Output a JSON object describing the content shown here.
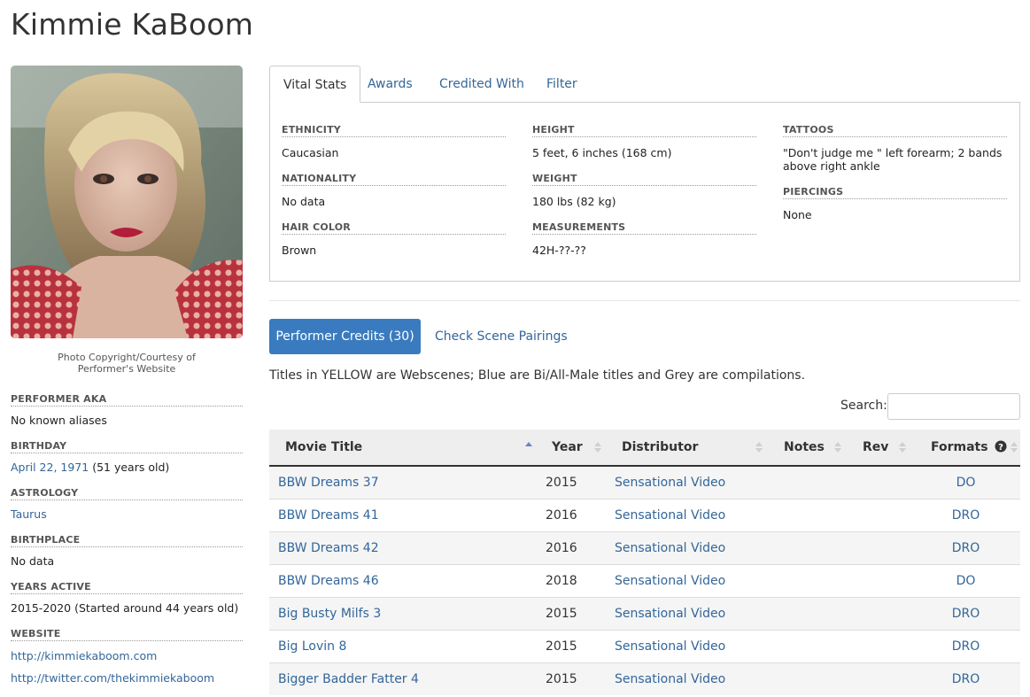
{
  "page": {
    "title": "Kimmie KaBoom"
  },
  "left": {
    "photo_credit_line1": "Photo Copyright/Courtesy of",
    "photo_credit_line2": "Performer's Website",
    "bio": [
      {
        "label": "Performer AKA",
        "value": "No known aliases",
        "link": false
      },
      {
        "label": "Birthday",
        "value_link": "April 22, 1971",
        "value_suffix": " (51 years old)"
      },
      {
        "label": "Astrology",
        "value": "Taurus",
        "link": true
      },
      {
        "label": "Birthplace",
        "value": "No data",
        "link": false
      },
      {
        "label": "Years Active",
        "value": "2015-2020 (Started around 44 years old)",
        "link": false
      },
      {
        "label": "Website",
        "links": [
          "http://kimmiekaboom.com",
          "http://twitter.com/thekimmiekaboom"
        ]
      }
    ]
  },
  "tabs": [
    {
      "label": "Vital Stats",
      "active": true
    },
    {
      "label": "Awards",
      "active": false
    },
    {
      "label": "Credited With",
      "active": false
    },
    {
      "label": "Filter",
      "active": false
    }
  ],
  "vital_stats": {
    "col1": [
      {
        "label": "Ethnicity",
        "value": "Caucasian"
      },
      {
        "label": "Nationality",
        "value": "No data"
      },
      {
        "label": "Hair Color",
        "value": "Brown"
      }
    ],
    "col2": [
      {
        "label": "Height",
        "value": "5 feet, 6 inches (168 cm)"
      },
      {
        "label": "Weight",
        "value": "180 lbs (82 kg)"
      },
      {
        "label": "Measurements",
        "value": "42H-??-??"
      }
    ],
    "col3": [
      {
        "label": "Tattoos",
        "value": "\"Don't judge me \" left forearm; 2 bands above right ankle"
      },
      {
        "label": "Piercings",
        "value": "None"
      }
    ]
  },
  "credits": {
    "button_label": "Performer Credits (30)",
    "pairings_label": "Check Scene Pairings",
    "legend": "Titles in YELLOW are Webscenes; Blue are Bi/All-Male titles and Grey are compilations.",
    "search_label": "Search:",
    "search_value": "",
    "columns": [
      "Movie Title",
      "Year",
      "Distributor",
      "Notes",
      "Rev",
      "Formats"
    ],
    "rows": [
      {
        "title": "BBW Dreams 37",
        "year": "2015",
        "distributor": "Sensational Video",
        "notes": "",
        "rev": "",
        "formats": "DO"
      },
      {
        "title": "BBW Dreams 41",
        "year": "2016",
        "distributor": "Sensational Video",
        "notes": "",
        "rev": "",
        "formats": "DRO"
      },
      {
        "title": "BBW Dreams 42",
        "year": "2016",
        "distributor": "Sensational Video",
        "notes": "",
        "rev": "",
        "formats": "DRO"
      },
      {
        "title": "BBW Dreams 46",
        "year": "2018",
        "distributor": "Sensational Video",
        "notes": "",
        "rev": "",
        "formats": "DO"
      },
      {
        "title": "Big Busty Milfs 3",
        "year": "2015",
        "distributor": "Sensational Video",
        "notes": "",
        "rev": "",
        "formats": "DRO"
      },
      {
        "title": "Big Lovin 8",
        "year": "2015",
        "distributor": "Sensational Video",
        "notes": "",
        "rev": "",
        "formats": "DRO"
      },
      {
        "title": "Bigger Badder Fatter 4",
        "year": "2015",
        "distributor": "Sensational Video",
        "notes": "",
        "rev": "",
        "formats": "DRO"
      }
    ]
  },
  "icons": {
    "help": "question-circle-icon",
    "sort": "sort-arrows-icon"
  },
  "colors": {
    "link": "#336699",
    "primary_button": "#3a7bbf",
    "header_bg": "#eeeeee",
    "odd_row": "#f5f5f5"
  }
}
